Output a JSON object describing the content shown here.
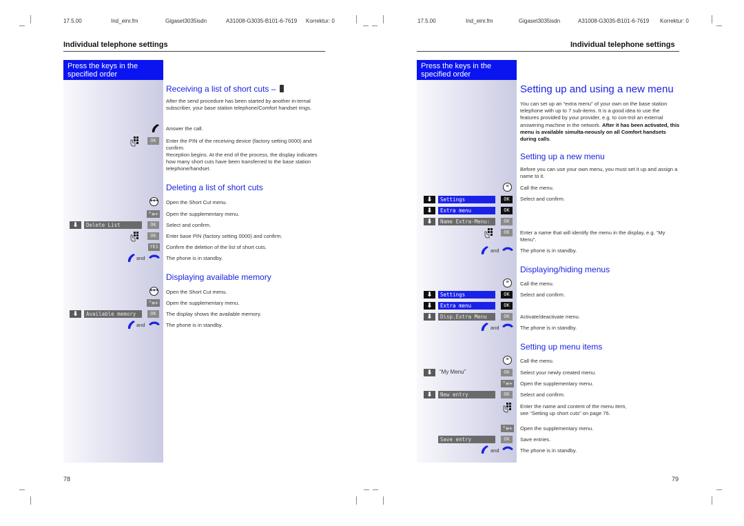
{
  "header_meta": {
    "date": "17.5.00",
    "file": "Ind_einr.fm",
    "product": "Gigaset3035isdn",
    "doc_number": "A31008-G3035-B101-6-7619",
    "correction": "Korrektur: 0"
  },
  "left_page": {
    "title": "Individual telephone settings",
    "sidebar_heading": "Press the keys in the specified order",
    "page_number": "78",
    "sections": [
      {
        "heading": "Receiving a list of short cuts –",
        "intro": "After the send procedure has been started by another in-ternal subscriber, your base station telephone/Comfort handset rings.",
        "steps": [
          {
            "keys": "handset-lift",
            "text": "Answer the call."
          },
          {
            "keys": "keypad OK",
            "text": "Enter the PIN of the receiving device (factory setting 0000) and confirm.",
            "text2": "Reception begins. At the end of the process, the display indicates how many short cuts have been transferred to the base station telephone/handset."
          }
        ]
      },
      {
        "heading": "Deleting a list of short cuts",
        "steps": [
          {
            "keys": "shortcut-key",
            "text": "Open the Short Cut menu."
          },
          {
            "keys": "supplementary-key",
            "text": "Open the supplementary menu."
          },
          {
            "display": "Delete List",
            "ok": "OK",
            "text": "Select and confirm."
          },
          {
            "keys": "keypad",
            "ok": "OK",
            "text": "Enter base PIN (factory setting 0000) and confirm."
          },
          {
            "key_label": "YES",
            "text": "Confirm the deletion of the list of short cuts."
          },
          {
            "and": "and",
            "text": "The phone is in standby."
          }
        ]
      },
      {
        "heading": "Displaying available memory",
        "steps": [
          {
            "text": "Open the Short Cut menu."
          },
          {
            "text": "Open the supplementary menu."
          },
          {
            "display": "Available memory",
            "ok": "OK",
            "text": "The display shows the available memory."
          },
          {
            "and": "and",
            "text": "The phone is in standby."
          }
        ]
      }
    ]
  },
  "right_page": {
    "title": "Individual telephone settings",
    "sidebar_heading": "Press the keys in the specified order",
    "page_number": "79",
    "main_heading": "Setting up and using a new menu",
    "intro_normal": "You can set up an “extra menu” of your own on the base station telephone with up to 7 sub-items. It is a good idea to use the features provided by your provider, e.g. to con-trol an external answering machine in the network. ",
    "intro_bold": "After it has been activated, this menu is available simulta-neously on all Comfort handsets during calls",
    "sections": [
      {
        "heading": "Setting up a new menu",
        "intro": "Before you can use your own menu, you must set it up and assign a name to it.",
        "steps": [
          {
            "text": "Call the menu."
          },
          {
            "display": "Settings",
            "ok": "OK",
            "text": "Select and confirm."
          },
          {
            "display": "Extra menu",
            "ok": "OK"
          },
          {
            "display": "Name Extra-Menu:",
            "ok": "OK"
          },
          {
            "ok": "OK",
            "text": "Enter a name that will identify the menu in the display, e.g. “My Menu”."
          },
          {
            "and": "and",
            "text": "The phone is in standby."
          }
        ]
      },
      {
        "heading": "Displaying/hiding menus",
        "steps": [
          {
            "text": "Call the menu."
          },
          {
            "display": "Settings",
            "ok": "OK",
            "text": "Select and confirm."
          },
          {
            "display": "Extra menu",
            "ok": "OK"
          },
          {
            "display": "Disp.Extra Menu",
            "ok": "OK",
            "text": "Activate/deactivate menu."
          },
          {
            "and": "and",
            "text": "The phone is in standby."
          }
        ]
      },
      {
        "heading": "Setting up menu items",
        "steps": [
          {
            "text": "Call the menu."
          },
          {
            "display": "“My Menu”",
            "ok": "OK",
            "text": "Select your newly created menu."
          },
          {
            "text": "Open the supplementary menu."
          },
          {
            "display": "New entry",
            "ok": "OK",
            "text": "Select and confirm."
          },
          {
            "text": "Enter the name and content of the menu item,",
            "text2": "see “Setting up short cuts” on page 76."
          },
          {
            "text": "Open the supplementary menu."
          },
          {
            "display": "Save entry",
            "ok": "OK",
            "text": "Save entries."
          },
          {
            "and": "and",
            "text": "The phone is in standby."
          }
        ]
      }
    ]
  },
  "icons": {
    "down_arrow": "⬇",
    "supplementary": "°≡+",
    "shortcut": "↤↦",
    "menu": "≡"
  },
  "colors": {
    "accent_blue": "#0a14f0",
    "heading_blue": "#1a22e0",
    "key_grey": "#6a6a6a"
  }
}
